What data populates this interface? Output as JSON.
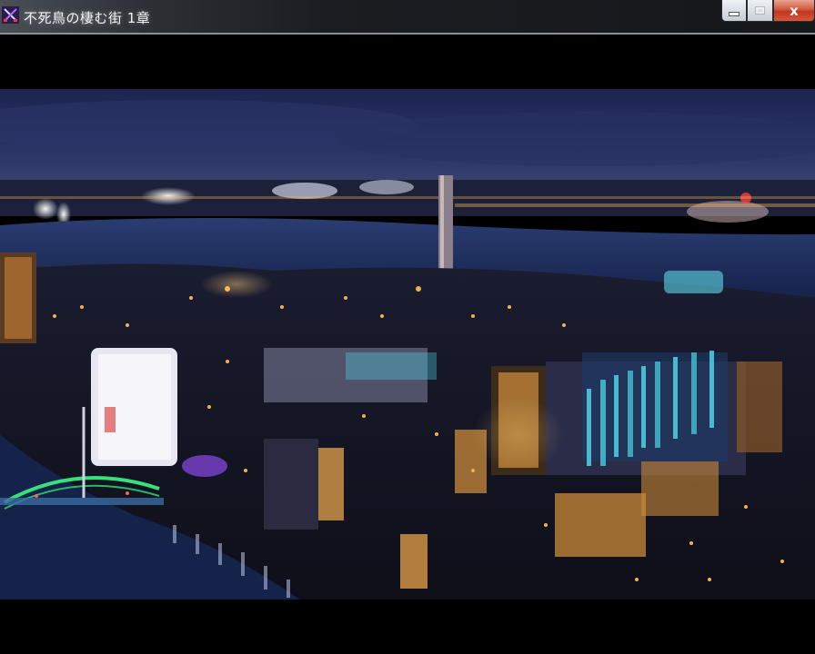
{
  "window": {
    "title": "不死鳥の棲む街 1章",
    "icon": "crossed-swords-icon"
  },
  "caption_buttons": {
    "minimize": "minimize-icon",
    "maximize": "maximize-icon",
    "close_glyph": "x"
  },
  "scene": {
    "description_icon": "night-city-illustration",
    "colors": {
      "sky": "#202a55",
      "water": "#1a2a55",
      "city_glow": "#f5b24a",
      "neon_cyan": "#4fd4e8",
      "bridge_green": "#37e07a"
    }
  }
}
